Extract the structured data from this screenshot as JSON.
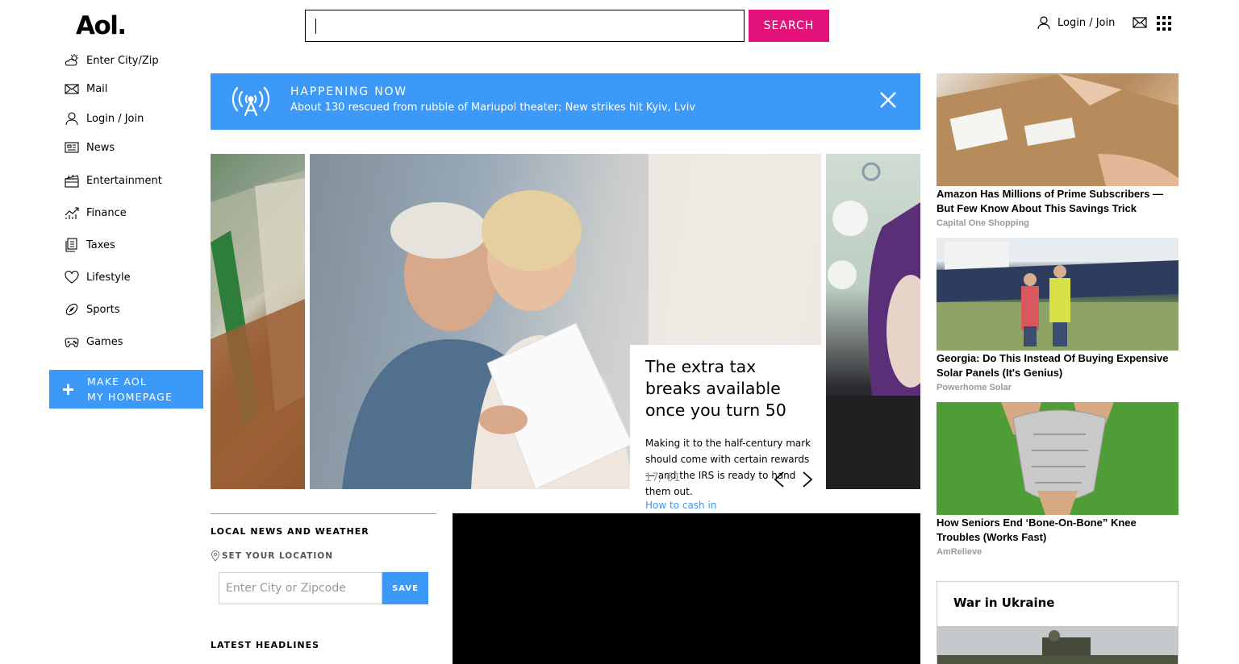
{
  "header": {
    "logo": "Aol.",
    "search_placeholder": "",
    "search_button": "SEARCH",
    "login": "Login / Join"
  },
  "sidebar": {
    "items": [
      {
        "label": "Enter City/Zip",
        "icon": "weather-icon"
      },
      {
        "label": "Mail",
        "icon": "mail-icon"
      },
      {
        "label": "Login / Join",
        "icon": "user-icon"
      },
      {
        "label": "News",
        "icon": "news-icon"
      },
      {
        "label": "Entertainment",
        "icon": "clapperboard-icon"
      },
      {
        "label": "Finance",
        "icon": "chart-icon"
      },
      {
        "label": "Taxes",
        "icon": "document-icon"
      },
      {
        "label": "Lifestyle",
        "icon": "heart-icon"
      },
      {
        "label": "Sports",
        "icon": "football-icon"
      },
      {
        "label": "Games",
        "icon": "gamepad-icon"
      }
    ],
    "make_aol_line1": "MAKE AOL",
    "make_aol_line2": "MY HOMEPAGE"
  },
  "happening": {
    "title": "HAPPENING NOW",
    "text": "About 130 rescued from rubble of Mariupol theater; New strikes hit Kyiv, Lviv"
  },
  "carousel": {
    "headline": "The extra tax breaks available once you turn 50",
    "summary": "Making it to the half-century mark should come with certain rewards — and the IRS is ready to hand them out.",
    "link": "How to cash in",
    "counter": "17/ 61"
  },
  "local": {
    "title": "LOCAL NEWS AND WEATHER",
    "set_location": "SET YOUR LOCATION",
    "city_placeholder": "Enter City or Zipcode",
    "save": "SAVE",
    "latest": "LATEST HEADLINES"
  },
  "ads": [
    {
      "title": "Amazon Has Millions of Prime Subscribers — But Few Know About This Savings Trick",
      "source": "Capital One Shopping"
    },
    {
      "title": "Georgia: Do This Instead Of Buying Expensive Solar Panels (It's Genius)",
      "source": "Powerhome Solar"
    },
    {
      "title": "How Seniors End ‘Bone-On-Bone” Knee Troubles (Works Fast)",
      "source": "AmRelieve"
    }
  ],
  "war": {
    "title": "War in Ukraine"
  },
  "colors": {
    "accent_blue": "#3c99f7",
    "search_pink": "#e4137b"
  }
}
